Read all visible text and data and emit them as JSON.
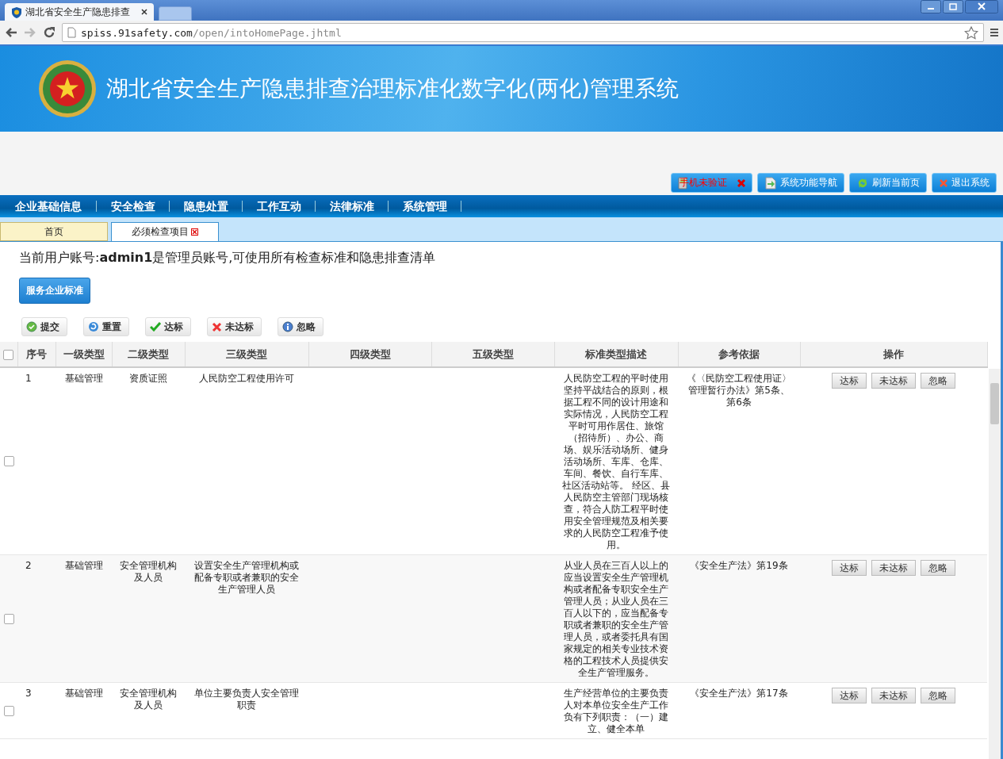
{
  "browser": {
    "tab_title": "湖北省安全生产隐患排查",
    "url_host": "spiss.91safety.com",
    "url_path": "/open/intoHomePage.jhtml"
  },
  "header": {
    "title": "湖北省安全生产隐患排查治理标准化数字化(两化)管理系统"
  },
  "top_buttons": [
    {
      "label": "手机未验证",
      "kind": "alert"
    },
    {
      "label": "系统功能导航",
      "kind": "nav"
    },
    {
      "label": "刷新当前页",
      "kind": "refresh"
    },
    {
      "label": "退出系统",
      "kind": "exit"
    }
  ],
  "nav": [
    "企业基础信息",
    "安全检查",
    "隐患处置",
    "工作互动",
    "法律标准",
    "系统管理"
  ],
  "tabs": [
    {
      "label": "首页",
      "selected": false,
      "closable": false
    },
    {
      "label": "必须检查项目",
      "selected": true,
      "closable": true
    }
  ],
  "notice": "当前用户账号:**admin1**是管理员账号,可使用所有检查标准和隐患排查清单",
  "service_button": "服务企业标准",
  "toolbar": [
    {
      "label": "提交",
      "kind": "submit"
    },
    {
      "label": "重置",
      "kind": "reset"
    },
    {
      "label": "达标",
      "kind": "pass"
    },
    {
      "label": "未达标",
      "kind": "fail"
    },
    {
      "label": "忽略",
      "kind": "ignore"
    }
  ],
  "table": {
    "select_all_checked": false,
    "columns": [
      "序号",
      "一级类型",
      "二级类型",
      "三级类型",
      "四级类型",
      "五级类型",
      "标准类型描述",
      "参考依据",
      "操作"
    ],
    "rows": [
      {
        "checked": false,
        "cells": [
          "1",
          "基础管理",
          "资质证照",
          "人民防空工程使用许可",
          "",
          "",
          "人民防空工程的平时使用坚持平战结合的原则，根据工程不同的设计用途和实际情况，人民防空工程平时可用作居住、旅馆（招待所）、办公、商场、娱乐活动场所、健身活动场所、车库、仓库、车间、餐饮、自行车库、社区活动站等。 经区、县人民防空主管部门现场核查，符合人防工程平时使用安全管理规范及相关要求的人民防空工程准予使用。",
          "《〈民防空工程使用证〉管理暂行办法》第5条、第6条"
        ],
        "actions": [
          "达标",
          "未达标",
          "忽略"
        ]
      },
      {
        "checked": false,
        "cells": [
          "2",
          "基础管理",
          "安全管理机构及人员",
          "设置安全生产管理机构或配备专职或者兼职的安全生产管理人员",
          "",
          "",
          "从业人员在三百人以上的应当设置安全生产管理机构或者配备专职安全生产管理人员；从业人员在三百人以下的，应当配备专职或者兼职的安全生产管理人员，或者委托具有国家规定的相关专业技术资格的工程技术人员提供安全生产管理服务。",
          "《安全生产法》第19条"
        ],
        "actions": [
          "达标",
          "未达标",
          "忽略"
        ]
      },
      {
        "checked": false,
        "cells": [
          "3",
          "基础管理",
          "安全管理机构及人员",
          "单位主要负责人安全管理职责",
          "",
          "",
          "生产经营单位的主要负责人对本单位安全生产工作负有下列职责：（一）建立、健全本单",
          "《安全生产法》第17条"
        ],
        "actions": [
          "达标",
          "未达标",
          "忽略"
        ]
      }
    ]
  }
}
